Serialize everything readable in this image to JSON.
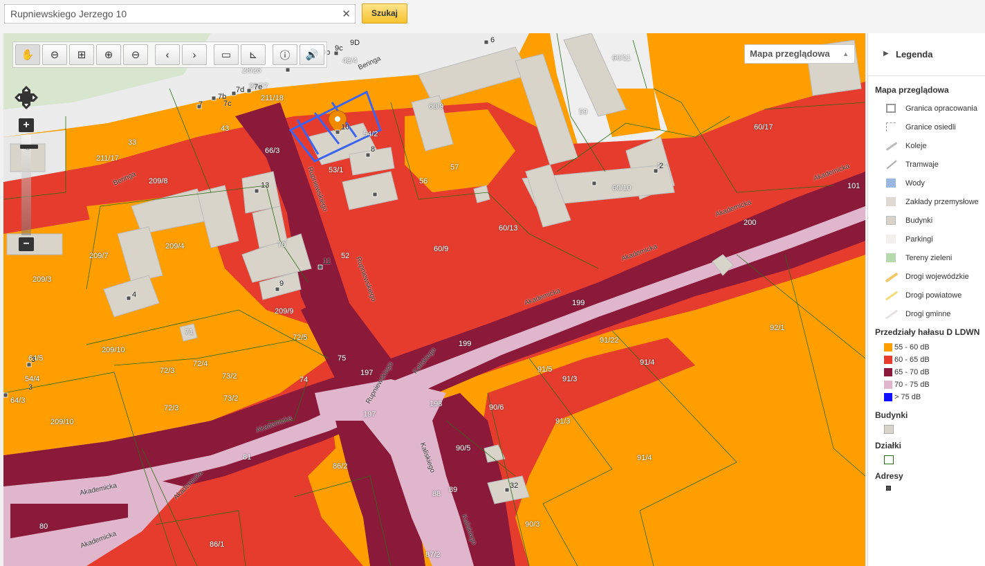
{
  "search": {
    "value": "Rupniewskiego Jerzego 10",
    "clear_icon": "✕",
    "button_label": "Szukaj"
  },
  "map": {
    "layer_select": "Mapa przeglądowa",
    "toolbar": [
      {
        "name": "pan-hand-icon",
        "glyph": "✋"
      },
      {
        "name": "zoom-out-box-icon",
        "glyph": "⊖"
      },
      {
        "name": "zoom-extent-icon",
        "glyph": "⊞"
      },
      {
        "name": "zoom-in-icon",
        "glyph": "⊕"
      },
      {
        "name": "zoom-out-icon",
        "glyph": "⊖"
      },
      {
        "name": "back-icon",
        "glyph": "‹"
      },
      {
        "name": "forward-icon",
        "glyph": "›"
      },
      {
        "name": "measure-distance-icon",
        "glyph": "▭"
      },
      {
        "name": "measure-area-icon",
        "glyph": "⊾"
      },
      {
        "name": "info-icon",
        "glyph": "ⓘ"
      },
      {
        "name": "sound-icon",
        "glyph": "🔊"
      }
    ],
    "zoom_in": "+",
    "zoom_out": "−",
    "labels": {
      "parcels": [
        "60/11",
        "60/9",
        "59",
        "60/17",
        "60/10",
        "101",
        "200",
        "199",
        "92/1",
        "91/22",
        "91/4",
        "91/5",
        "91/3",
        "90/6",
        "91/3",
        "91/4",
        "90/5",
        "90/3",
        "89",
        "88",
        "87/2",
        "86/2",
        "86/1",
        "80",
        "81",
        "74",
        "73/2",
        "72/3",
        "73/2",
        "72/4",
        "72/5",
        "209/10",
        "209/10",
        "72/3",
        "209/9",
        "209/7",
        "209/3",
        "209/4",
        "209/8",
        "211/17",
        "211/18",
        "43",
        "33",
        "53/1",
        "56",
        "57",
        "60/13",
        "60/9",
        "52",
        "75",
        "197",
        "197",
        "198",
        "199",
        "71",
        "70",
        "64/3",
        "54/4",
        "64/5",
        "42/4",
        "28/26",
        "28/27",
        "66/3",
        "54/2",
        "2"
      ],
      "streets": [
        "Beringa",
        "Beringa",
        "Rupniewskiego",
        "Rupniewskiego",
        "Rupniewskiego",
        "Akademicka",
        "Akademicka",
        "Akademicka",
        "Akademicka",
        "Akademicka",
        "Akademicka",
        "Akademicka",
        "Akademicka",
        "Kaliskiego",
        "Kaliskiego",
        "Kaliskiego"
      ],
      "addresses": [
        "6",
        "9b",
        "9c",
        "9D",
        "7",
        "7b",
        "7c",
        "7d",
        "7e",
        "10",
        "8",
        "13",
        "11",
        "9",
        "4",
        "3",
        "2",
        "32",
        "3",
        "3"
      ]
    },
    "colors": {
      "noise_55_60": "#ff9e00",
      "noise_60_65": "#e63c2e",
      "noise_65_70": "#8b1a3a",
      "noise_70_75": "#e0b6cd",
      "noise_75": "#1010ff",
      "building": "#d8d4ca",
      "parcel_line": "#2a6a14",
      "selection": "#3b64f0"
    }
  },
  "legend": {
    "title": "Legenda",
    "section_overview": "Mapa przeglądowa",
    "overview_items": [
      "Granica opracowania",
      "Granice osiedli",
      "Koleje",
      "Tramwaje",
      "Wody",
      "Zakłady przemysłowe",
      "Budynki",
      "Parkingi",
      "Tereny zieleni",
      "Drogi wojewódzkie",
      "Drogi powiatowe",
      "Drogi gminne"
    ],
    "section_noise": "Przedziały hałasu D LDWN",
    "noise_items": [
      "55 - 60 dB",
      "60 - 65 dB",
      "65 - 70 dB",
      "70 - 75 dB",
      "> 75 dB"
    ],
    "section_buildings": "Budynki",
    "section_parcels": "Działki",
    "section_addresses": "Adresy"
  }
}
